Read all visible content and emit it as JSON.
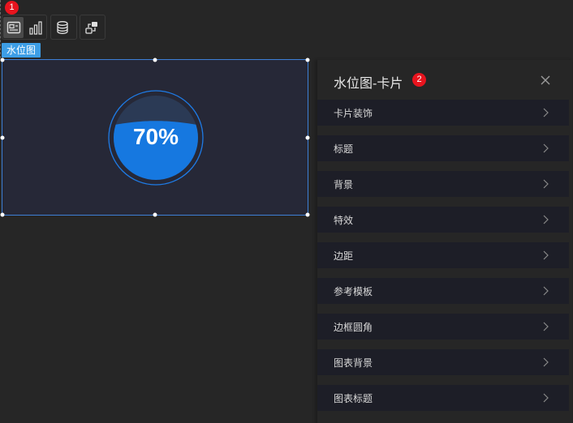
{
  "toolbar": {
    "marker": "1",
    "groups": [
      {
        "buttons": [
          {
            "icon": "image-card-icon",
            "active": true
          },
          {
            "icon": "bar-chart-icon",
            "active": false
          }
        ]
      },
      {
        "buttons": [
          {
            "icon": "database-icon",
            "active": false
          }
        ]
      },
      {
        "buttons": [
          {
            "icon": "interaction-icon",
            "active": false
          }
        ]
      }
    ]
  },
  "component": {
    "tag": "水位图"
  },
  "gauge": {
    "value_label": "70%",
    "level_fraction": 0.7,
    "colors": {
      "fill": "#1678e0",
      "ring": "#1e7be6",
      "empty": "#2b3a55",
      "background": "#262837"
    }
  },
  "panel": {
    "title": "水位图-卡片",
    "marker": "2",
    "items": [
      {
        "label": "卡片装饰"
      },
      {
        "label": "标题"
      },
      {
        "label": "背景"
      },
      {
        "label": "特效"
      },
      {
        "label": "边距"
      },
      {
        "label": "参考模板"
      },
      {
        "label": "边框圆角"
      },
      {
        "label": "图表背景"
      },
      {
        "label": "图表标题"
      }
    ]
  },
  "colors": {
    "page_bg": "#262626",
    "accent": "#3d9ee6",
    "selection": "#3d7fd6",
    "marker": "#e8141e",
    "item_bg": "#1d1e27"
  }
}
